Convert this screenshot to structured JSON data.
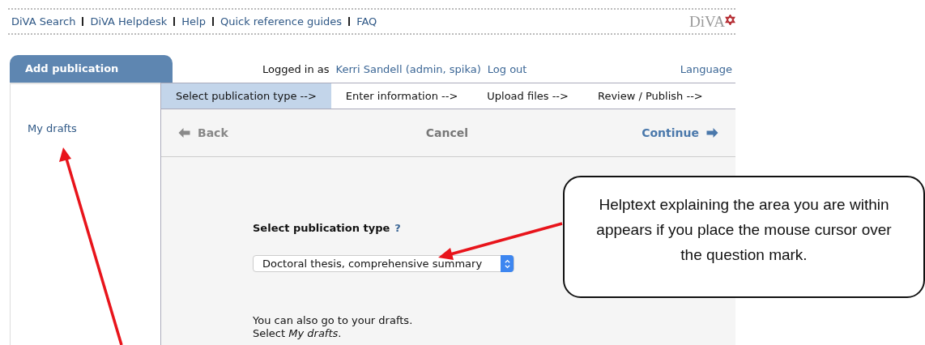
{
  "top_links": [
    "DiVA Search",
    "DiVA Helpdesk",
    "Help",
    "Quick reference guides",
    "FAQ"
  ],
  "logo": {
    "text": "DiVA"
  },
  "panel_tab": {
    "label": "Add publication"
  },
  "account": {
    "prefix": "Logged in as",
    "user": "Kerri Sandell (admin, spika)",
    "logout": "Log out",
    "language": "Language"
  },
  "sidebar": {
    "items": [
      {
        "label": "My drafts"
      }
    ]
  },
  "steps": [
    {
      "label": "Select publication type -->",
      "selected": true
    },
    {
      "label": "Enter information -->",
      "selected": false
    },
    {
      "label": "Upload files -->",
      "selected": false
    },
    {
      "label": "Review / Publish -->",
      "selected": false
    }
  ],
  "toolbar": {
    "back": "Back",
    "cancel": "Cancel",
    "continue": "Continue"
  },
  "form": {
    "label": "Select publication type",
    "help": "?",
    "select_value": "Doctoral thesis, comprehensive summary",
    "note": [
      "You can also go to your drafts.",
      "Select *My drafts*."
    ]
  },
  "annotation": {
    "callout": "Helptext explaining the area you are within appears if you place the mouse cursor over the question mark."
  }
}
